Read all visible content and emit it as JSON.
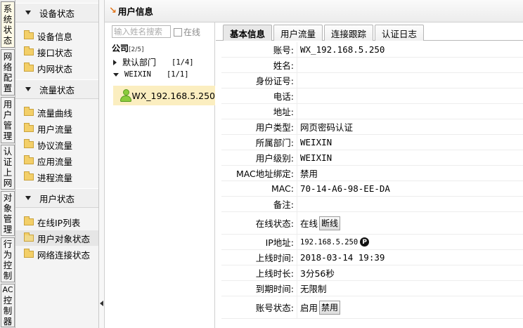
{
  "rail": {
    "tabs": [
      {
        "label": [
          "系",
          "统",
          "状",
          "态"
        ],
        "active": true
      },
      {
        "label": [
          "网",
          "络",
          "配",
          "置"
        ],
        "active": false
      },
      {
        "label": [
          "用",
          "户",
          "管",
          "理"
        ],
        "active": false
      },
      {
        "label": [
          "认",
          "证",
          "上",
          "网"
        ],
        "active": false
      },
      {
        "label": [
          "对",
          "象",
          "管",
          "理"
        ],
        "active": false
      },
      {
        "label": [
          "行",
          "为",
          "控",
          "制"
        ],
        "active": false
      },
      {
        "label": [
          "AC",
          "控",
          "制",
          "器"
        ],
        "active": false
      }
    ]
  },
  "menu": {
    "groups": [
      {
        "title": "设备状态",
        "items": [
          "设备信息",
          "接口状态",
          "内网状态"
        ]
      },
      {
        "title": "流量状态",
        "items": [
          "流量曲线",
          "用户流量",
          "协议流量",
          "应用流量",
          "进程流量"
        ]
      },
      {
        "title": "用户状态",
        "items": [
          "在线IP列表",
          "用户对象状态",
          "网络连接状态"
        ]
      }
    ],
    "selected": "用户对象状态"
  },
  "panel": {
    "title": "用户信息",
    "title_arrow": "↘"
  },
  "tree": {
    "search_placeholder": "输入姓名搜索",
    "online_label": "在线",
    "root_label": "公司",
    "root_count": "[2/5]",
    "nodes": [
      {
        "label": "默认部门",
        "count": "[1/4]",
        "expanded": false
      },
      {
        "label": "WEIXIN",
        "count": "[1/1]",
        "expanded": true
      }
    ],
    "user": "WX_192.168.5.250"
  },
  "tabs": [
    "基本信息",
    "用户流量",
    "连接跟踪",
    "认证日志"
  ],
  "active_tab": "基本信息",
  "info": {
    "rows": [
      {
        "label": "账号:",
        "value": "WX_192.168.5.250"
      },
      {
        "label": "姓名:",
        "value": ""
      },
      {
        "label": "身份证号:",
        "value": ""
      },
      {
        "label": "电话:",
        "value": ""
      },
      {
        "label": "地址:",
        "value": ""
      },
      {
        "label": "用户类型:",
        "value": "网页密码认证"
      },
      {
        "label": "所属部门:",
        "value": "WEIXIN"
      },
      {
        "label": "用户级别:",
        "value": "WEIXIN"
      },
      {
        "label": "MAC地址绑定:",
        "value": "禁用"
      },
      {
        "label": "MAC:",
        "value": "70-14-A6-98-EE-DA"
      },
      {
        "label": "备注:",
        "value": ""
      },
      {
        "label": "在线状态:",
        "value": "在线",
        "button": "断线"
      },
      {
        "label": "IP地址:",
        "value": "192.168.5.250",
        "badge": "P"
      },
      {
        "label": "上线时间:",
        "value": "2018-03-14 19:39"
      },
      {
        "label": "上线时长:",
        "value": "3分56秒"
      },
      {
        "label": "到期时间:",
        "value": "无限制"
      },
      {
        "label": "账号状态:",
        "value": "启用",
        "button": "禁用"
      }
    ]
  }
}
